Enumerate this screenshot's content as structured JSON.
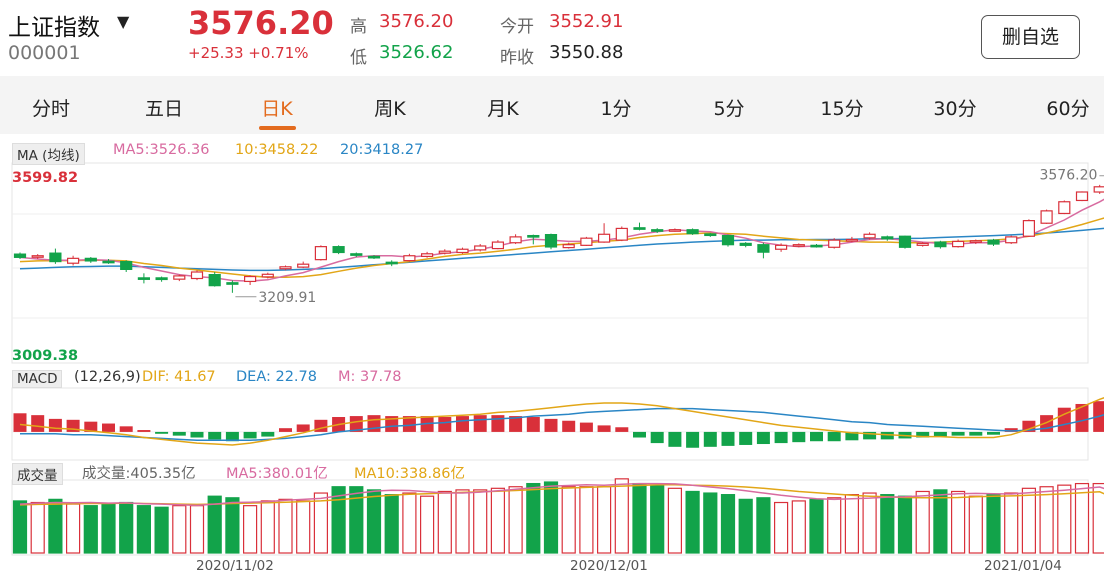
{
  "header": {
    "name": "上证指数",
    "code": "000001",
    "price": "3576.20",
    "change": "+25.33",
    "change_pct": "+0.71%",
    "high_label": "高",
    "high": "3576.20",
    "low_label": "低",
    "low": "3526.62",
    "open_label": "今开",
    "open": "3552.91",
    "prev_close_label": "昨收",
    "prev_close": "3550.88",
    "remove_watchlist": "删自选"
  },
  "tabs": [
    "分时",
    "五日",
    "日K",
    "周K",
    "月K",
    "1分",
    "5分",
    "15分",
    "30分",
    "60分"
  ],
  "active_tab": "日K",
  "colors": {
    "up": "#d9303a",
    "down": "#12a34a",
    "accent": "#e36b1e",
    "ma5": "#d86ba0",
    "ma10": "#e2a617",
    "ma20": "#2a86c5"
  },
  "ma_panel": {
    "badge": "MA (均线)",
    "ma5": "MA5:3526.36",
    "ma10": "10:3458.22",
    "ma20": "20:3418.27",
    "axis_max": "3599.82",
    "axis_min": "3009.38",
    "high_marker": "3576.20",
    "low_marker": "3209.91"
  },
  "macd_panel": {
    "badge": "MACD",
    "params": "(12,26,9)",
    "dif": "DIF: 41.67",
    "dea": "DEA: 22.78",
    "m": "M: 37.78"
  },
  "vol_panel": {
    "badge": "成交量",
    "vol": "成交量:405.35亿",
    "ma5": "MA5:380.01亿",
    "ma10": "MA10:338.86亿"
  },
  "date_labels": [
    "2020/11/02",
    "2020/12/01",
    "2021/01/04"
  ],
  "chart_data": {
    "type": "candlestick",
    "y_range": [
      3009.38,
      3599.82
    ],
    "candles": [
      {
        "o": 3335,
        "c": 3325,
        "h": 3340,
        "l": 3320
      },
      {
        "o": 3327,
        "c": 3330,
        "h": 3335,
        "l": 3320
      },
      {
        "o": 3338,
        "c": 3312,
        "h": 3352,
        "l": 3305
      },
      {
        "o": 3307,
        "c": 3322,
        "h": 3330,
        "l": 3300
      },
      {
        "o": 3322,
        "c": 3314,
        "h": 3326,
        "l": 3308
      },
      {
        "o": 3313,
        "c": 3311,
        "h": 3320,
        "l": 3305
      },
      {
        "o": 3312,
        "c": 3288,
        "h": 3316,
        "l": 3280
      },
      {
        "o": 3262,
        "c": 3258,
        "h": 3276,
        "l": 3245
      },
      {
        "o": 3262,
        "c": 3257,
        "h": 3266,
        "l": 3250
      },
      {
        "o": 3258,
        "c": 3268,
        "h": 3272,
        "l": 3252
      },
      {
        "o": 3260,
        "c": 3280,
        "h": 3285,
        "l": 3255
      },
      {
        "o": 3272,
        "c": 3238,
        "h": 3280,
        "l": 3235
      },
      {
        "o": 3247,
        "c": 3243,
        "h": 3254,
        "l": 3216
      },
      {
        "o": 3251,
        "c": 3266,
        "h": 3270,
        "l": 3240
      },
      {
        "o": 3265,
        "c": 3273,
        "h": 3278,
        "l": 3260
      },
      {
        "o": 3290,
        "c": 3296,
        "h": 3300,
        "l": 3285
      },
      {
        "o": 3295,
        "c": 3304,
        "h": 3312,
        "l": 3292
      },
      {
        "o": 3318,
        "c": 3358,
        "h": 3362,
        "l": 3315
      },
      {
        "o": 3358,
        "c": 3340,
        "h": 3362,
        "l": 3335
      },
      {
        "o": 3336,
        "c": 3332,
        "h": 3340,
        "l": 3326
      },
      {
        "o": 3328,
        "c": 3326,
        "h": 3332,
        "l": 3320
      },
      {
        "o": 3310,
        "c": 3306,
        "h": 3316,
        "l": 3298
      },
      {
        "o": 3315,
        "c": 3330,
        "h": 3336,
        "l": 3312
      },
      {
        "o": 3328,
        "c": 3336,
        "h": 3342,
        "l": 3324
      },
      {
        "o": 3338,
        "c": 3344,
        "h": 3350,
        "l": 3334
      },
      {
        "o": 3340,
        "c": 3350,
        "h": 3355,
        "l": 3336
      },
      {
        "o": 3348,
        "c": 3360,
        "h": 3366,
        "l": 3343
      },
      {
        "o": 3352,
        "c": 3372,
        "h": 3378,
        "l": 3350
      },
      {
        "o": 3370,
        "c": 3388,
        "h": 3396,
        "l": 3366
      },
      {
        "o": 3392,
        "c": 3388,
        "h": 3395,
        "l": 3365
      },
      {
        "o": 3395,
        "c": 3357,
        "h": 3398,
        "l": 3350
      },
      {
        "o": 3355,
        "c": 3364,
        "h": 3370,
        "l": 3352
      },
      {
        "o": 3362,
        "c": 3384,
        "h": 3388,
        "l": 3360
      },
      {
        "o": 3372,
        "c": 3396,
        "h": 3430,
        "l": 3370
      },
      {
        "o": 3378,
        "c": 3414,
        "h": 3420,
        "l": 3375
      },
      {
        "o": 3416,
        "c": 3412,
        "h": 3432,
        "l": 3408
      },
      {
        "o": 3410,
        "c": 3407,
        "h": 3415,
        "l": 3400
      },
      {
        "o": 3408,
        "c": 3410,
        "h": 3414,
        "l": 3404
      },
      {
        "o": 3410,
        "c": 3398,
        "h": 3414,
        "l": 3394
      },
      {
        "o": 3397,
        "c": 3395,
        "h": 3400,
        "l": 3388
      },
      {
        "o": 3392,
        "c": 3364,
        "h": 3395,
        "l": 3358
      },
      {
        "o": 3368,
        "c": 3362,
        "h": 3372,
        "l": 3356
      },
      {
        "o": 3364,
        "c": 3341,
        "h": 3370,
        "l": 3322
      },
      {
        "o": 3350,
        "c": 3362,
        "h": 3368,
        "l": 3342
      },
      {
        "o": 3362,
        "c": 3364,
        "h": 3368,
        "l": 3356
      },
      {
        "o": 3362,
        "c": 3360,
        "h": 3366,
        "l": 3355
      },
      {
        "o": 3356,
        "c": 3378,
        "h": 3384,
        "l": 3352
      },
      {
        "o": 3378,
        "c": 3380,
        "h": 3388,
        "l": 3372
      },
      {
        "o": 3385,
        "c": 3396,
        "h": 3402,
        "l": 3380
      },
      {
        "o": 3388,
        "c": 3382,
        "h": 3392,
        "l": 3376
      },
      {
        "o": 3390,
        "c": 3356,
        "h": 3392,
        "l": 3352
      },
      {
        "o": 3362,
        "c": 3368,
        "h": 3372,
        "l": 3358
      },
      {
        "o": 3372,
        "c": 3358,
        "h": 3376,
        "l": 3352
      },
      {
        "o": 3358,
        "c": 3374,
        "h": 3380,
        "l": 3355
      },
      {
        "o": 3372,
        "c": 3376,
        "h": 3380,
        "l": 3366
      },
      {
        "o": 3378,
        "c": 3366,
        "h": 3382,
        "l": 3360
      },
      {
        "o": 3370,
        "c": 3388,
        "h": 3392,
        "l": 3366
      },
      {
        "o": 3390,
        "c": 3438,
        "h": 3442,
        "l": 3388
      },
      {
        "o": 3430,
        "c": 3468,
        "h": 3472,
        "l": 3428
      },
      {
        "o": 3460,
        "c": 3496,
        "h": 3500,
        "l": 3458
      },
      {
        "o": 3500,
        "c": 3526,
        "h": 3528,
        "l": 3498
      },
      {
        "o": 3526,
        "c": 3542,
        "h": 3548,
        "l": 3520
      },
      {
        "o": 3552,
        "c": 3576,
        "h": 3576,
        "l": 3526
      }
    ],
    "ma5": [
      3325,
      3320,
      3316,
      3316,
      3318,
      3316,
      3308,
      3294,
      3283,
      3272,
      3266,
      3262,
      3254,
      3252,
      3256,
      3268,
      3278,
      3295,
      3312,
      3326,
      3330,
      3330,
      3326,
      3330,
      3338,
      3342,
      3350,
      3360,
      3373,
      3381,
      3378,
      3374,
      3374,
      3378,
      3385,
      3396,
      3404,
      3410,
      3406,
      3404,
      3394,
      3384,
      3370,
      3362,
      3358,
      3360,
      3364,
      3372,
      3380,
      3382,
      3378,
      3372,
      3368,
      3366,
      3370,
      3370,
      3378,
      3392,
      3416,
      3440,
      3470,
      3496,
      3526
    ],
    "ma10": [
      3312,
      3314,
      3315,
      3315,
      3316,
      3316,
      3314,
      3306,
      3300,
      3292,
      3286,
      3280,
      3274,
      3268,
      3264,
      3264,
      3266,
      3272,
      3282,
      3292,
      3300,
      3306,
      3312,
      3320,
      3328,
      3334,
      3338,
      3344,
      3350,
      3358,
      3362,
      3366,
      3370,
      3374,
      3378,
      3386,
      3392,
      3396,
      3398,
      3400,
      3398,
      3396,
      3390,
      3385,
      3380,
      3378,
      3376,
      3374,
      3372,
      3372,
      3370,
      3370,
      3372,
      3374,
      3376,
      3378,
      3382,
      3390,
      3400,
      3412,
      3426,
      3442,
      3458
    ],
    "ma20": [
      3290,
      3292,
      3294,
      3296,
      3297,
      3298,
      3298,
      3296,
      3294,
      3292,
      3290,
      3288,
      3286,
      3285,
      3285,
      3286,
      3288,
      3290,
      3294,
      3298,
      3302,
      3306,
      3310,
      3314,
      3318,
      3322,
      3326,
      3330,
      3334,
      3338,
      3342,
      3346,
      3350,
      3354,
      3358,
      3362,
      3366,
      3369,
      3372,
      3374,
      3376,
      3378,
      3378,
      3379,
      3379,
      3380,
      3380,
      3381,
      3382,
      3382,
      3383,
      3384,
      3386,
      3388,
      3390,
      3392,
      3394,
      3397,
      3400,
      3404,
      3408,
      3413,
      3418
    ],
    "macd": [
      20,
      18,
      14,
      13,
      11,
      9,
      6,
      2,
      -2,
      -4,
      -6,
      -8,
      -10,
      -7,
      -5,
      4,
      8,
      13,
      16,
      17,
      18,
      17,
      17,
      17,
      16,
      17,
      18,
      18,
      17,
      16,
      14,
      12,
      10,
      7,
      5,
      -6,
      -12,
      -16,
      -17,
      -16,
      -15,
      -14,
      -13,
      -12,
      -11,
      -10,
      -10,
      -9,
      -8,
      -8,
      -7,
      -6,
      -5,
      -4,
      -4,
      -3,
      4,
      12,
      18,
      26,
      30,
      33,
      37.78
    ],
    "dif": [
      8,
      6,
      4,
      3,
      1,
      -1,
      -3,
      -6,
      -8,
      -10,
      -12,
      -13,
      -14,
      -12,
      -9,
      -5,
      -1,
      4,
      8,
      11,
      13,
      14,
      15,
      16,
      17,
      18,
      19,
      21,
      22,
      24,
      26,
      28,
      30,
      31,
      31,
      30,
      28,
      25,
      22,
      19,
      16,
      13,
      10,
      7,
      5,
      3,
      1,
      -1,
      -2,
      -3,
      -4,
      -5,
      -5,
      -6,
      -6,
      -6,
      -3,
      3,
      10,
      19,
      27,
      35,
      41.67
    ],
    "dea": [
      -2,
      -2,
      -2,
      -3,
      -3,
      -4,
      -5,
      -6,
      -7,
      -8,
      -9,
      -9,
      -9,
      -9,
      -8,
      -7,
      -5,
      -3,
      0,
      2,
      4,
      6,
      7,
      9,
      10,
      12,
      13,
      14,
      15,
      17,
      18,
      19,
      21,
      22,
      23,
      24,
      25,
      25,
      25,
      24,
      23,
      22,
      21,
      19,
      17,
      15,
      13,
      11,
      10,
      8,
      7,
      6,
      5,
      4,
      3,
      2,
      1,
      2,
      4,
      8,
      12,
      17,
      22.78
    ],
    "volume": [
      330,
      320,
      340,
      310,
      300,
      310,
      320,
      300,
      290,
      300,
      300,
      360,
      350,
      300,
      330,
      340,
      330,
      380,
      420,
      420,
      400,
      370,
      380,
      360,
      390,
      400,
      400,
      410,
      420,
      440,
      450,
      420,
      420,
      420,
      470,
      440,
      430,
      410,
      390,
      380,
      370,
      340,
      350,
      320,
      330,
      340,
      350,
      370,
      380,
      370,
      360,
      390,
      400,
      390,
      360,
      370,
      380,
      410,
      420,
      430,
      440,
      440,
      405.35
    ],
    "vol_ma5": [
      310,
      315,
      320,
      318,
      320,
      316,
      318,
      312,
      310,
      306,
      302,
      310,
      320,
      322,
      326,
      334,
      340,
      346,
      362,
      378,
      392,
      398,
      396,
      388,
      380,
      380,
      386,
      394,
      404,
      414,
      424,
      428,
      432,
      430,
      436,
      440,
      440,
      438,
      430,
      418,
      408,
      394,
      380,
      366,
      354,
      344,
      340,
      344,
      348,
      354,
      356,
      362,
      368,
      376,
      378,
      376,
      374,
      382,
      390,
      398,
      408,
      418,
      380.01
    ],
    "vol_ma10": [
      305,
      308,
      310,
      312,
      314,
      314,
      316,
      314,
      312,
      310,
      308,
      310,
      314,
      316,
      318,
      322,
      326,
      330,
      338,
      348,
      358,
      366,
      372,
      376,
      380,
      384,
      388,
      392,
      396,
      402,
      408,
      412,
      416,
      420,
      424,
      428,
      432,
      432,
      430,
      428,
      424,
      418,
      410,
      400,
      390,
      382,
      374,
      366,
      360,
      356,
      352,
      350,
      350,
      352,
      356,
      360,
      362,
      366,
      370,
      376,
      382,
      388,
      338.86
    ],
    "vol_range": [
      0,
      450
    ],
    "macd_range": [
      -28,
      45
    ]
  }
}
